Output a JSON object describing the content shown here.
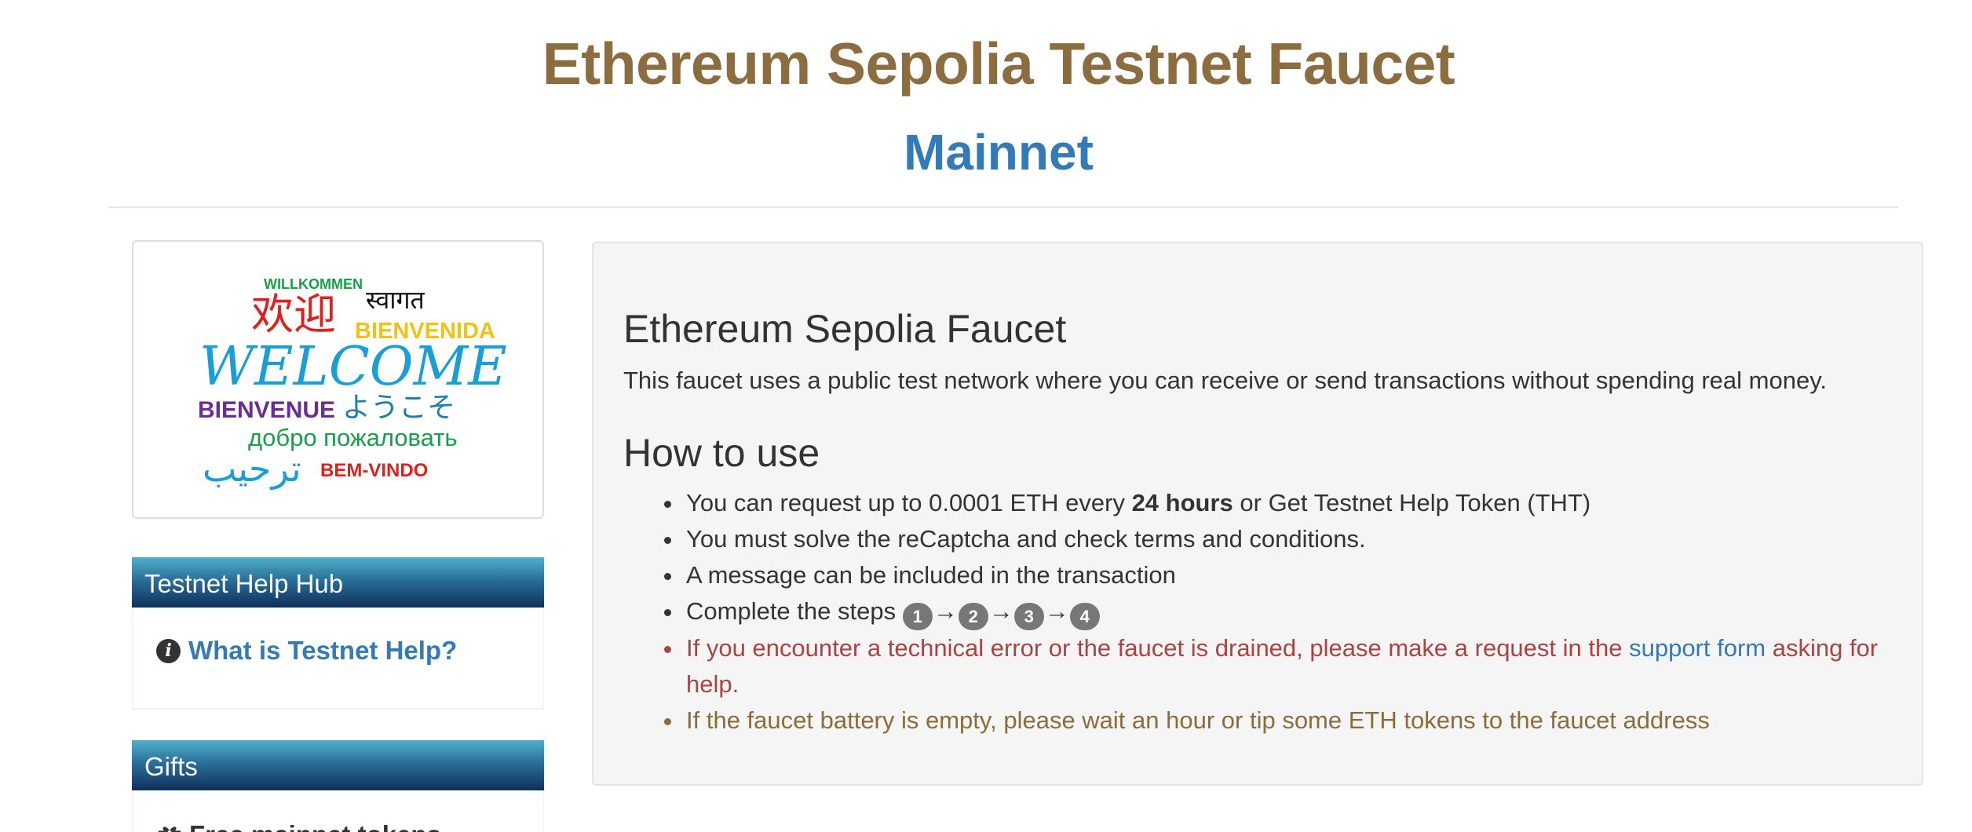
{
  "header": {
    "title": "Ethereum Sepolia Testnet Faucet",
    "network_link": "Mainnet"
  },
  "welcome_banner": {
    "words": [
      "WILLKOMMEN",
      "स्वागत",
      "欢迎",
      "BIENVENIDA",
      "WELCOME",
      "BIENVENUE",
      "ようこそ",
      "добро пожаловать",
      "ترحيب",
      "BEM-VINDO"
    ]
  },
  "sidebar": {
    "help_hub": {
      "heading": "Testnet Help Hub",
      "link_label": "What is Testnet Help?",
      "icon": "info-circle-icon"
    },
    "gifts": {
      "heading": "Gifts",
      "link_label": "Free mainnet tokens",
      "icon": "gift-icon"
    }
  },
  "main": {
    "title": "Ethereum Sepolia Faucet",
    "description": "This faucet uses a public test network where you can receive or send transactions without spending real money.",
    "how_to_heading": "How to use",
    "items": {
      "request_prefix": "You can request up to 0.0001 ETH every ",
      "request_bold": "24 hours",
      "request_suffix": " or Get Testnet Help Token (THT)",
      "captcha": "You must solve the reCaptcha and check terms and conditions.",
      "message": "A message can be included in the transaction",
      "steps_prefix": "Complete the steps ",
      "steps": [
        "1",
        "2",
        "3",
        "4"
      ],
      "arrow": "→",
      "error_prefix": "If you encounter a technical error or the faucet is drained, please make a request in the ",
      "error_link": "support form",
      "error_suffix": " asking for help.",
      "battery": "If the faucet battery is empty, please wait an hour or tip some ETH tokens to the faucet address"
    }
  },
  "colors": {
    "title": "#8c6d3f",
    "link": "#337ab7",
    "danger": "#a94442",
    "warning": "#8a6d3b",
    "panel_heading_top": "#4fb0cb",
    "panel_heading_bottom": "#10305a"
  }
}
